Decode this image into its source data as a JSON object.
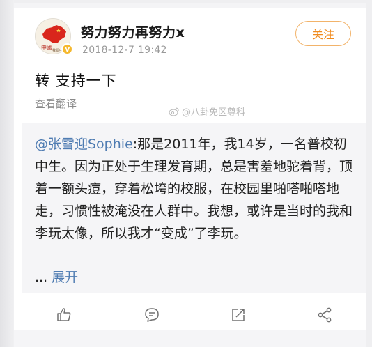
{
  "post": {
    "username": "努力努力再努力x",
    "timestamp": "2018-12-7 19:42",
    "follow_label": "关注",
    "repost_text": "转 支持一下",
    "translate_label": "查看翻译",
    "watermark": "@八卦免区尊科",
    "avatar_text_top": "中國",
    "avatar_text_bottom": "我爱中国"
  },
  "quoted": {
    "mention": "@张雪迎Sophie",
    "text": ":那是2011年，我14岁，一名普校初中生。因为正处于生理发育期，总是害羞地驼着背，顶着一额头痘，穿着松垮的校服，在校园里啪嗒啪嗒地走，习惯性被淹没在人群中。我想，或许是当时的我和李玩太像，所以我才“变成”了李玩。",
    "ellipsis": "...",
    "expand_label": "展开"
  },
  "actions": [
    "like-icon",
    "comment-icon",
    "repost-icon",
    "share-icon"
  ],
  "colors": {
    "accent": "#f08a1c",
    "link": "#4f7cb2",
    "quote_bg": "#f5f5f7",
    "verified": "#f5b82e"
  }
}
